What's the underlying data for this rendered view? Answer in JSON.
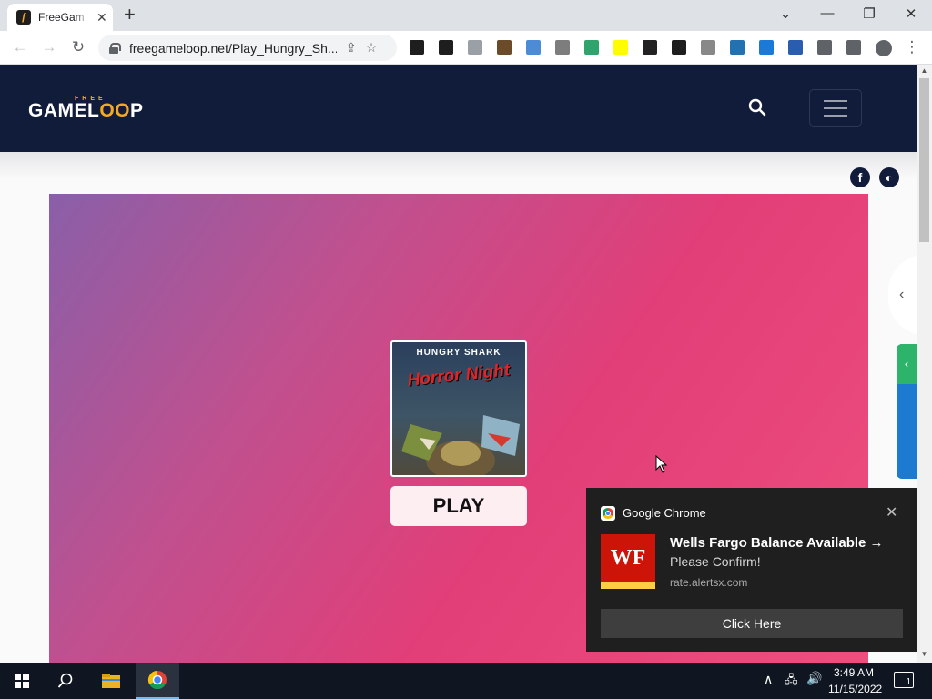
{
  "browser": {
    "tab_title": "FreeGam",
    "favicon_glyph": "ƒ",
    "close_tab": "✕",
    "new_tab": "+",
    "window_controls": {
      "dropdown": "⌄",
      "minimize": "—",
      "restore": "❐",
      "close": "✕"
    },
    "nav": {
      "back": "←",
      "forward": "→",
      "reload": "↻"
    },
    "url": "freegameloop.net/Play_Hungry_Sh...",
    "extensions": [
      {
        "name": "minecraft-ext-icon",
        "color": "#1e1e1e"
      },
      {
        "name": "xbox-ext-icon",
        "color": "#1e1e1e"
      },
      {
        "name": "sparkle-ext-icon",
        "color": "#9aa0a6"
      },
      {
        "name": "game-ext-icon",
        "color": "#6b4b2a"
      },
      {
        "name": "photo-ext-icon",
        "color": "#4c8bd6"
      },
      {
        "name": "s-ext-icon",
        "color": "#7d7d7d"
      },
      {
        "name": "refresh-green-ext-icon",
        "color": "#30a46c"
      },
      {
        "name": "snapchat-ext-icon",
        "color": "#fffc00"
      },
      {
        "name": "map-pin-ext-icon",
        "color": "#222222"
      },
      {
        "name": "q-ext-icon",
        "color": "#1e1e1e"
      },
      {
        "name": "art-ext-icon",
        "color": "#888888"
      },
      {
        "name": "wordpress-ext-icon",
        "color": "#2271b1"
      },
      {
        "name": "bing-ext-icon",
        "color": "#1b7ad8"
      },
      {
        "name": "globe-ext-icon",
        "color": "#2a5db0"
      },
      {
        "name": "puzzle-ext-icon",
        "color": "#5f6368"
      },
      {
        "name": "sidepanel-ext-icon",
        "color": "#5f6368"
      },
      {
        "name": "profile-ext-icon",
        "color": "#5f6368"
      }
    ]
  },
  "site": {
    "logo_free": "FREE",
    "logo_game": "GAME",
    "logo_l": "L",
    "logo_oo": "OO",
    "logo_p": "P",
    "social_facebook": "f",
    "social_theme": "◐",
    "game_thumbnail_title": "HUNGRY SHARK",
    "game_thumbnail_subtitle": "Horror Night",
    "play_label": "PLAY",
    "side_tab_arrow": "‹",
    "feedback_arrow": "‹"
  },
  "notification": {
    "app_name": "Google Chrome",
    "close": "✕",
    "logo_text": "WF",
    "title": "Wells Fargo Balance Available →",
    "body": "Please Confirm!",
    "source": "rate.alertsx.com",
    "action_label": "Click Here"
  },
  "taskbar": {
    "time": "3:49 AM",
    "date": "11/15/2022",
    "notification_count": "1",
    "tray_up": "∧"
  },
  "colors": {
    "header_bg": "#111c3a",
    "accent_orange": "#f7a823",
    "game_gradient_start": "#8a5fa8",
    "game_gradient_end": "#ee4f7e",
    "wf_red": "#cd1409",
    "wf_yellow": "#ffcd41"
  }
}
